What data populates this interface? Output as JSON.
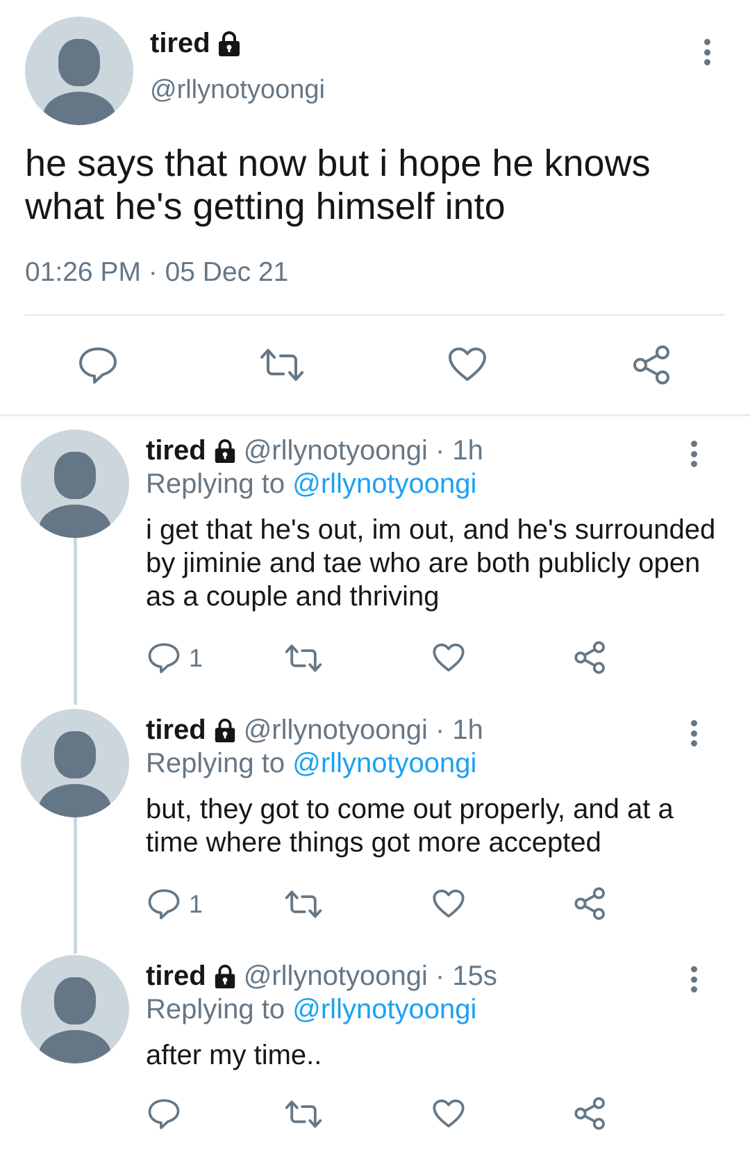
{
  "main_tweet": {
    "display_name": "tired",
    "handle": "@rllynotyoongi",
    "text": "he says that now but i hope he knows what he's getting himself into",
    "timestamp": "01:26 PM · 05 Dec 21",
    "icons": {
      "lock": "lock-icon",
      "more": "more-vertical-icon",
      "reply": "reply-bubble-icon",
      "retweet": "retweet-icon",
      "like": "heart-icon",
      "share": "share-icon"
    }
  },
  "replies": [
    {
      "display_name": "tired",
      "handle_time": "@rllynotyoongi · 1h",
      "replying_prefix": "Replying to",
      "replying_to": "@rllynotyoongi",
      "text": "i get that he's out, im out, and he's surrounded by jiminie and tae who are both publicly open as a couple and thriving",
      "reply_count": "1"
    },
    {
      "display_name": "tired",
      "handle_time": "@rllynotyoongi · 1h",
      "replying_prefix": "Replying to",
      "replying_to": "@rllynotyoongi",
      "text": "but, they got to come out properly, and at a time where things got more accepted",
      "reply_count": "1"
    },
    {
      "display_name": "tired",
      "handle_time": "@rllynotyoongi · 15s",
      "replying_prefix": "Replying to",
      "replying_to": "@rllynotyoongi",
      "text": "after my time..",
      "reply_count": ""
    }
  ],
  "colors": {
    "text": "#14171a",
    "secondary": "#657786",
    "link": "#1da1f2",
    "avatar_bg": "#ccd6dd",
    "divider": "#e1e8ed"
  }
}
